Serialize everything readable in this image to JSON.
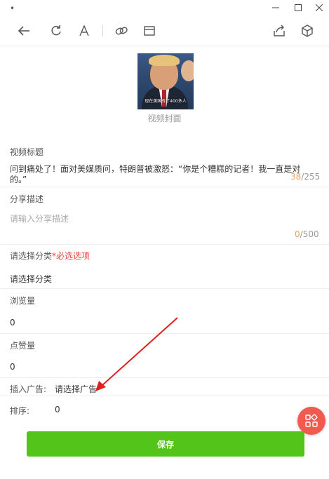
{
  "titlebar": {
    "dot": "•",
    "minimize": "—",
    "maximize": "□",
    "close": "✕"
  },
  "toolbar": {
    "back_icon": "arrow-left-icon",
    "refresh_icon": "refresh-icon",
    "font_icon": "font-icon",
    "link_icon": "link-icon",
    "window_icon": "window-icon",
    "share_icon": "share-icon",
    "cube_icon": "cube-icon"
  },
  "cover": {
    "caption": "现在美国有了400多人",
    "label": "视频封面"
  },
  "form": {
    "title_label": "视频标题",
    "title_value": "问到痛处了！面对美媒质问，特朗普被激怒：“你是个糟糕的记者！我一直是对的。”",
    "title_count": "38",
    "title_max": "/255",
    "share_label": "分享描述",
    "share_placeholder": "请输入分享描述",
    "share_count": "0",
    "share_max": "/500",
    "category_label": "请选择分类",
    "category_required": "*必选选项",
    "category_value": "请选择分类",
    "views_label": "浏览量",
    "views_value": "0",
    "likes_label": "点赞量",
    "likes_value": "0",
    "ad_label": "插入广告:",
    "ad_value": "请选择广告",
    "sort_label": "排序:",
    "sort_value": "0"
  },
  "actions": {
    "save_label": "保存",
    "fab_icon": "grid-apps-icon"
  },
  "colors": {
    "accent_green": "#52c41a",
    "fab_red": "#f25a50",
    "required_red": "#e64340",
    "counter_orange": "#f5a05a",
    "annotation_arrow": "#e02020"
  }
}
